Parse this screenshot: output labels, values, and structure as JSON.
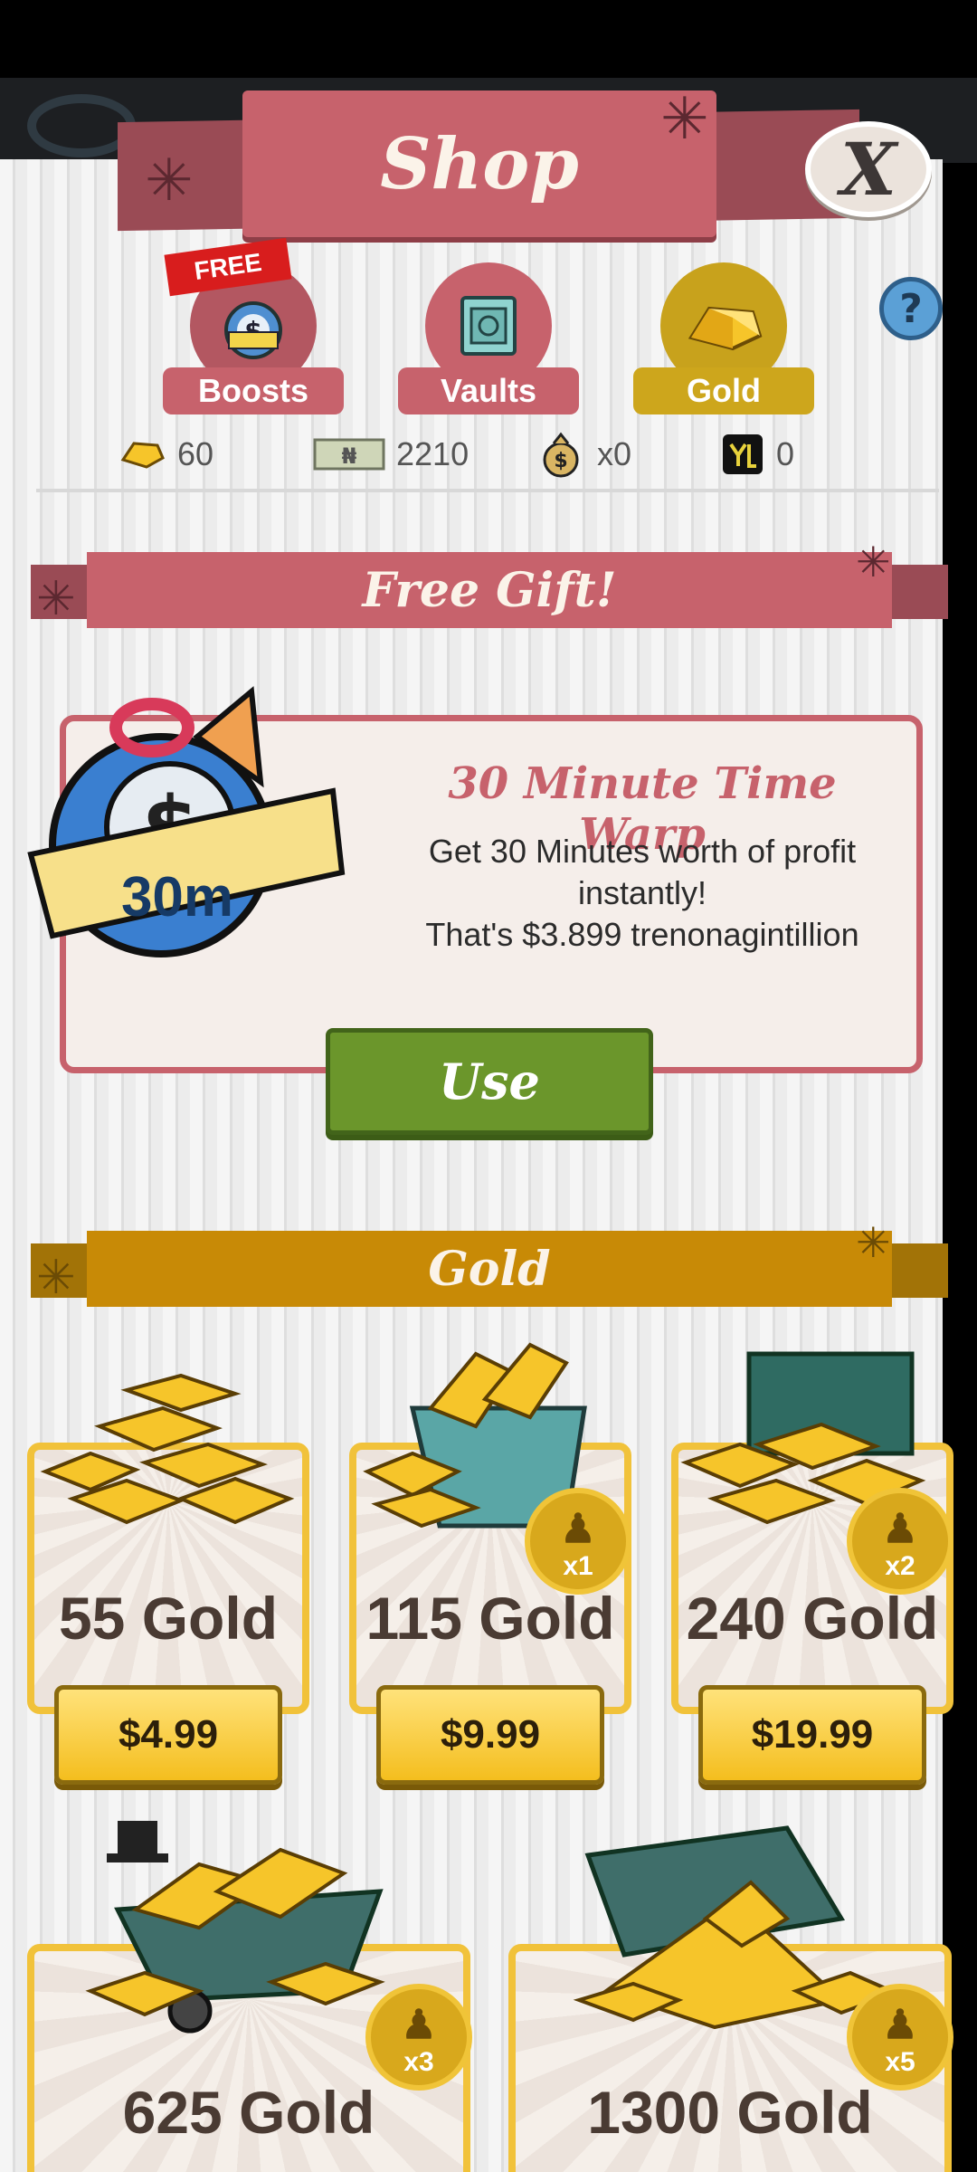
{
  "header": {
    "title": "Shop",
    "close_label": "X"
  },
  "tabs": [
    {
      "label": "Boosts",
      "ribbon": "FREE",
      "icon": "stopwatch-icon"
    },
    {
      "label": "Vaults",
      "icon": "vault-icon"
    },
    {
      "label": "Gold",
      "icon": "gold-icon",
      "selected": true
    }
  ],
  "help_label": "?",
  "currencies": {
    "gold": "60",
    "cash": "2210",
    "moneybag": "x0",
    "mega": "0"
  },
  "free_gift": {
    "section_title": "Free Gift!",
    "item_badge": "30m",
    "title": "30 Minute Time Warp",
    "desc_line1": "Get 30 Minutes worth of profit",
    "desc_line2": "instantly!",
    "desc_line3": "That's $3.899 trenonagintillion",
    "button": "Use"
  },
  "gold_section": {
    "title": "Gold",
    "products": [
      {
        "name": "55 Gold",
        "price": "$4.99"
      },
      {
        "name": "115 Gold",
        "price": "$9.99",
        "badge": "x1"
      },
      {
        "name": "240 Gold",
        "price": "$19.99",
        "badge": "x2"
      },
      {
        "name": "625 Gold",
        "badge": "x3"
      },
      {
        "name": "1300 Gold",
        "badge": "x5"
      }
    ]
  },
  "colors": {
    "accent_pink": "#c7626c",
    "gold": "#c88a06",
    "use_green": "#6b962b"
  }
}
